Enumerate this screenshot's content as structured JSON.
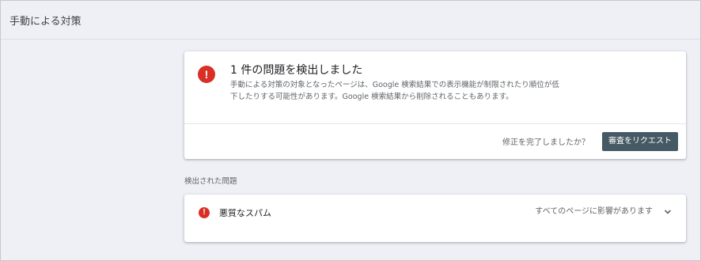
{
  "header": {
    "title": "手動による対策"
  },
  "summary_card": {
    "icon": "alert-icon",
    "title": "1 件の問題を検出しました",
    "description": "手動による対策の対象となったページは、Google 検索結果での表示機能が制限されたり順位が低下したりする可能性があります。Google 検索結果から削除されることもあります。",
    "fix_question": "修正を完了しましたか？",
    "review_button": "審査をリクエスト",
    "accent_color": "#d93025",
    "button_color": "#455a64"
  },
  "detected_issues": {
    "label": "検出された問題",
    "items": [
      {
        "icon": "alert-icon",
        "name": "悪質なスパム",
        "scope": "すべてのページに影響があります",
        "expand_icon": "chevron-down-icon"
      }
    ]
  }
}
